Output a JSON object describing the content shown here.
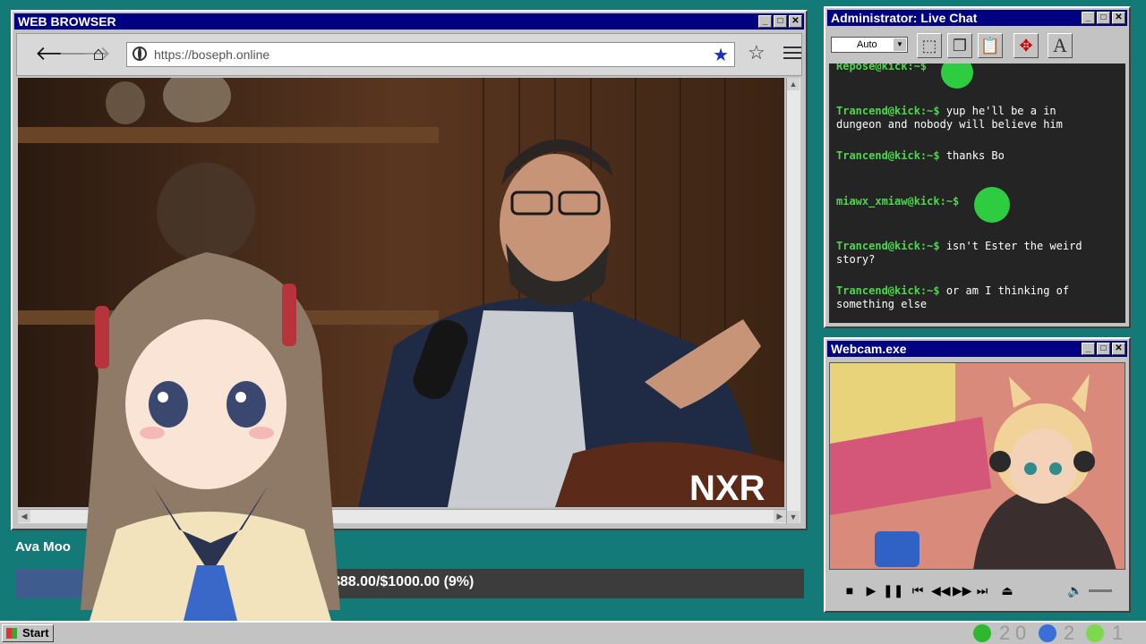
{
  "browser": {
    "title": "WEB BROWSER",
    "url": "https://boseph.online",
    "video_watermark": "NXR"
  },
  "chat": {
    "title": "Administrator: Live Chat",
    "text_size": "Auto",
    "messages": [
      {
        "user": "Repose@kick:~$",
        "text": ""
      },
      {
        "user": "Trancend@kick:~$",
        "text": "yup he'll be a in dungeon and nobody will believe him"
      },
      {
        "user": "Trancend@kick:~$",
        "text": "thanks Bo"
      },
      {
        "user": "miawx_xmiaw@kick:~$",
        "text": ""
      },
      {
        "user": "Trancend@kick:~$",
        "text": "isn't Ester the weird story?"
      },
      {
        "user": "Trancend@kick:~$",
        "text": "or am I thinking of something else"
      }
    ]
  },
  "webcam": {
    "title": "Webcam.exe"
  },
  "donation": {
    "name": "Ava Moo",
    "progress_text": "$88.00/$1000.00 (9%)",
    "progress_fraction": 0.09
  },
  "taskbar": {
    "start_label": "Start",
    "counts": [
      "2",
      "0",
      "2",
      "1"
    ]
  },
  "colors": {
    "desktop": "#137a78",
    "titlebar": "#000080",
    "chat_user": "#4cd64c",
    "progress_fill": "#3e5d8e"
  }
}
